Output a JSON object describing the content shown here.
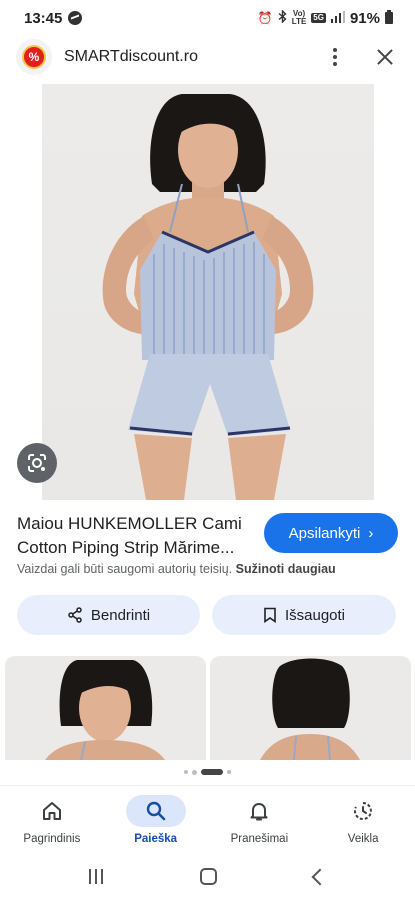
{
  "status_bar": {
    "time": "13:45",
    "network_top": "Vo)",
    "network_bottom": "LTE",
    "network_gen": "5G",
    "battery": "91%"
  },
  "app_bar": {
    "site_name": "SMARTdiscount.ro",
    "logo_text": "%"
  },
  "product": {
    "title": "Maiou HUNKEMOLLER Cami Cotton Piping Strip Mărime...",
    "visit_label": "Apsilankyti",
    "copyright_text": "Vaizdai gali būti saugomi autorių teisių.",
    "learn_more": "Sužinoti daugiau"
  },
  "actions": {
    "share_label": "Bendrinti",
    "save_label": "Išsaugoti"
  },
  "bottom_nav": {
    "items": [
      {
        "label": "Pagrindinis",
        "icon": "home-icon"
      },
      {
        "label": "Paieška",
        "icon": "search-icon",
        "active": true
      },
      {
        "label": "Pranešimai",
        "icon": "bell-icon"
      },
      {
        "label": "Veikla",
        "icon": "activity-icon"
      }
    ]
  },
  "colors": {
    "accent": "#1a73e8",
    "pill_bg": "#e8eefb",
    "active_nav_bg": "#dce6fb"
  }
}
